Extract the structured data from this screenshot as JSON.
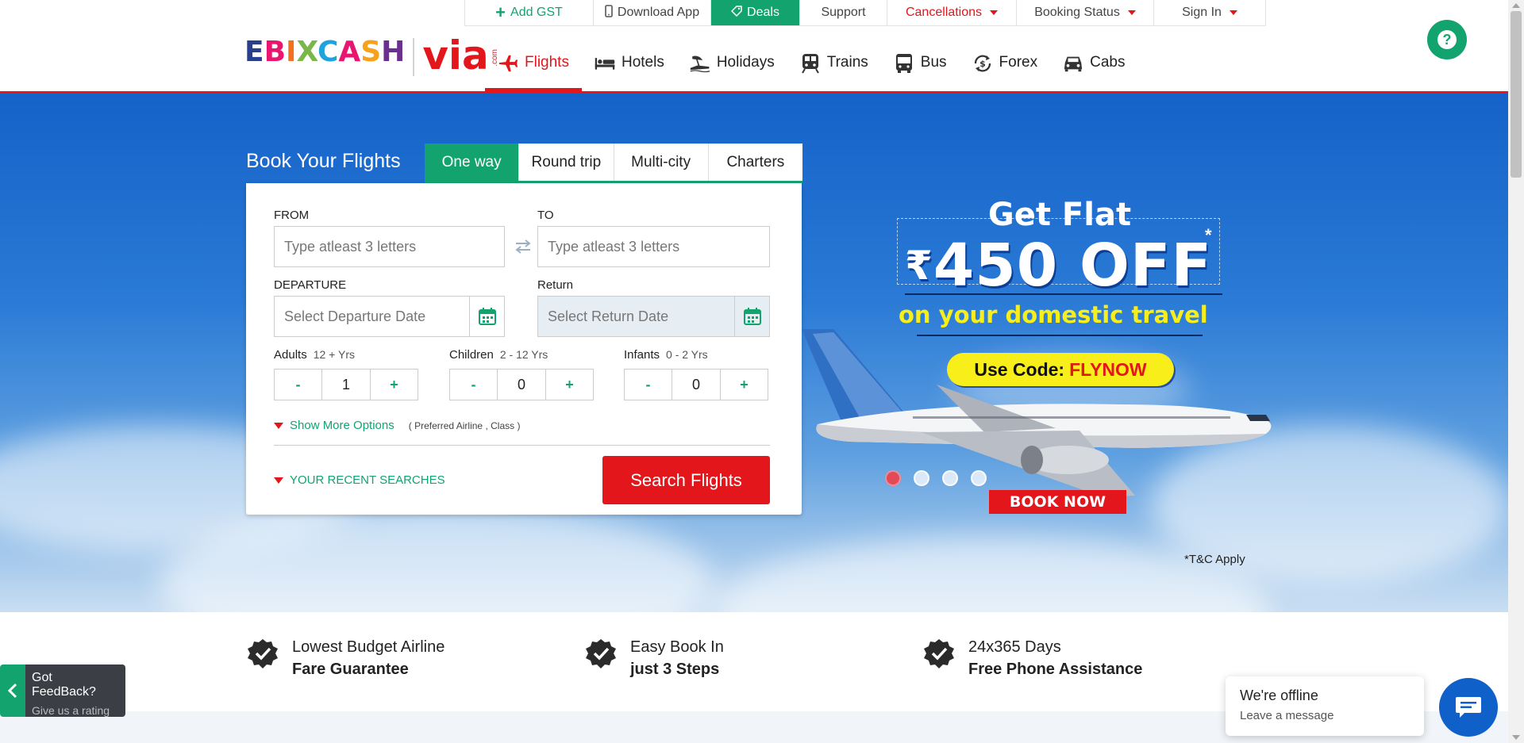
{
  "utility_bar": {
    "items": [
      {
        "label": "Add GST",
        "icon": "plus-icon"
      },
      {
        "label": "Download App",
        "icon": "mobile-icon"
      },
      {
        "label": "Deals",
        "icon": "tag-icon"
      },
      {
        "label": "Support"
      },
      {
        "label": "Cancellations"
      },
      {
        "label": "Booking Status"
      },
      {
        "label": "Sign In"
      }
    ]
  },
  "help": {
    "label": "?"
  },
  "logo": {
    "brand_left": "EBIXCASH",
    "brand_right": "via",
    "brand_suffix": ".com"
  },
  "nav": {
    "items": [
      {
        "label": "Flights",
        "icon": "plane-icon",
        "active": true
      },
      {
        "label": "Hotels",
        "icon": "bed-icon"
      },
      {
        "label": "Holidays",
        "icon": "beach-icon"
      },
      {
        "label": "Trains",
        "icon": "train-icon"
      },
      {
        "label": "Bus",
        "icon": "bus-icon"
      },
      {
        "label": "Forex",
        "icon": "forex-icon"
      },
      {
        "label": "Cabs",
        "icon": "car-icon"
      }
    ]
  },
  "booking": {
    "title": "Book Your Flights",
    "tabs": [
      "One way",
      "Round trip",
      "Multi-city",
      "Charters"
    ],
    "active_tab": "One way",
    "from_label": "FROM",
    "to_label": "TO",
    "from_placeholder": "Type atleast 3 letters",
    "to_placeholder": "Type atleast 3 letters",
    "departure_label": "DEPARTURE",
    "return_label": "Return",
    "departure_placeholder": "Select Departure Date",
    "return_placeholder": "Select Return Date",
    "adults": {
      "label": "Adults",
      "range": "12 + Yrs",
      "value": "1"
    },
    "children": {
      "label": "Children",
      "range": "2 - 12 Yrs",
      "value": "0"
    },
    "infants": {
      "label": "Infants",
      "range": "0 - 2 Yrs",
      "value": "0"
    },
    "minus": "-",
    "plus": "+",
    "more_options": "Show More Options",
    "more_options_sub": "( Preferred Airline , Class )",
    "recent_searches": "YOUR RECENT SEARCHES",
    "search_button": "Search Flights"
  },
  "promo": {
    "line1": "Get Flat",
    "currency": "₹",
    "amount": "450 OFF",
    "asterisk": "*",
    "line3": "on your domestic travel",
    "code_prefix": "Use Code:",
    "code": "FLYNOW",
    "cta": "BOOK NOW",
    "slide_count": 4,
    "active_slide": 1,
    "tnc": "*T&C Apply"
  },
  "features": [
    {
      "line1": "Lowest Budget Airline",
      "line2": "Fare Guarantee"
    },
    {
      "line1": "Easy Book In",
      "line2": "just 3 Steps"
    },
    {
      "line1": "24x365 Days",
      "line2": "Free Phone Assistance"
    }
  ],
  "feedback": {
    "title": "Got FeedBack?",
    "subtitle": "Give us a rating"
  },
  "chat": {
    "status": "We're offline",
    "action": "Leave a message"
  },
  "colors": {
    "brand_green": "#13a36f",
    "brand_red": "#e3161c",
    "chat_blue": "#1060c9"
  }
}
